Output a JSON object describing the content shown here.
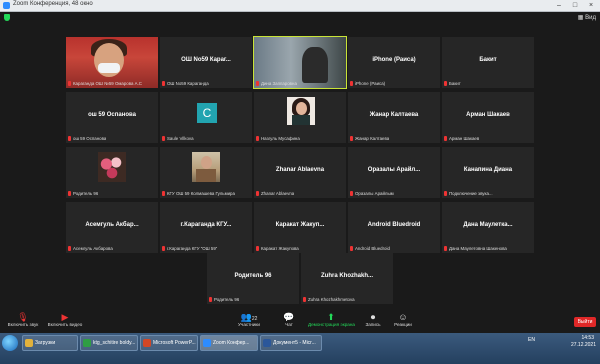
{
  "window": {
    "title": "Zoom Конференция, 48 окно"
  },
  "view_label": "Вид",
  "tiles": [
    {
      "name": "",
      "label": "Караганда ОШ №59 Омарова А.С"
    },
    {
      "name": "ОШ No59 Караг...",
      "label": "ОШ No59 Караганда"
    },
    {
      "name": "",
      "label": "Дина Заппаровна"
    },
    {
      "name": "iPhone (Раиса)",
      "label": "iPhone (Раиса)"
    },
    {
      "name": "Бакит",
      "label": "Бакит"
    },
    {
      "name": "ош 59 Оспанова",
      "label": "ош 59 Оспанова"
    },
    {
      "name": "",
      "label": "Saule Vilkova"
    },
    {
      "name": "",
      "label": "Назгуль Мусафина"
    },
    {
      "name": "Жанар Калтаева",
      "label": "Жанар Калтаева"
    },
    {
      "name": "Арман Шакаев",
      "label": "Арман Шакаев"
    },
    {
      "name": "",
      "label": "Родитель 96"
    },
    {
      "name": "",
      "label": "КГУ ОШ 59 Колмашева Гульмира"
    },
    {
      "name": "Zhanar Ablaevna",
      "label": "Zhanar Ablaevna"
    },
    {
      "name": "Оразалы Арайл...",
      "label": "Оразалы Арайлым"
    },
    {
      "name": "Канапина Диана",
      "label": "Подключение звука..."
    },
    {
      "name": "Асемгуль Акбар...",
      "label": "Асемгуль Акбарова"
    },
    {
      "name": "г.Караганда КГУ...",
      "label": "г.Караганда КГУ \"ОШ 59\""
    },
    {
      "name": "Каракат Жакуп...",
      "label": "Каракат Жакупова"
    },
    {
      "name": "Android Bluedroid",
      "label": "Android Bluedroid"
    },
    {
      "name": "Дана Маулетка...",
      "label": "Дана Маулетовна Шакенова"
    },
    {
      "name": "Родитель 96",
      "label": "Родитель 96"
    },
    {
      "name": "Zuhra Khozhakh...",
      "label": "Zuhra Khozhakhmetova"
    }
  ],
  "controls": {
    "mic": "Включить звук",
    "video": "Включить видео",
    "participants": "Участники",
    "participants_count": "22",
    "chat": "Чат",
    "share": "Демонстрация экрана",
    "record": "Запись",
    "reactions": "Реакции",
    "leave": "Выйти"
  },
  "taskbar": {
    "items": [
      {
        "label": "Загрузки",
        "color": "#e2b23c"
      },
      {
        "label": "ktg_schitire boldy...",
        "color": "#2f9e44"
      },
      {
        "label": "Microsoft PowerP...",
        "color": "#d24726"
      },
      {
        "label": "Zoom Конфер...",
        "color": "#2d8cff"
      },
      {
        "label": "Документ5 - Micr...",
        "color": "#2b579a"
      }
    ],
    "lang": "EN",
    "time": "14:53",
    "date": "27.12.2021"
  }
}
